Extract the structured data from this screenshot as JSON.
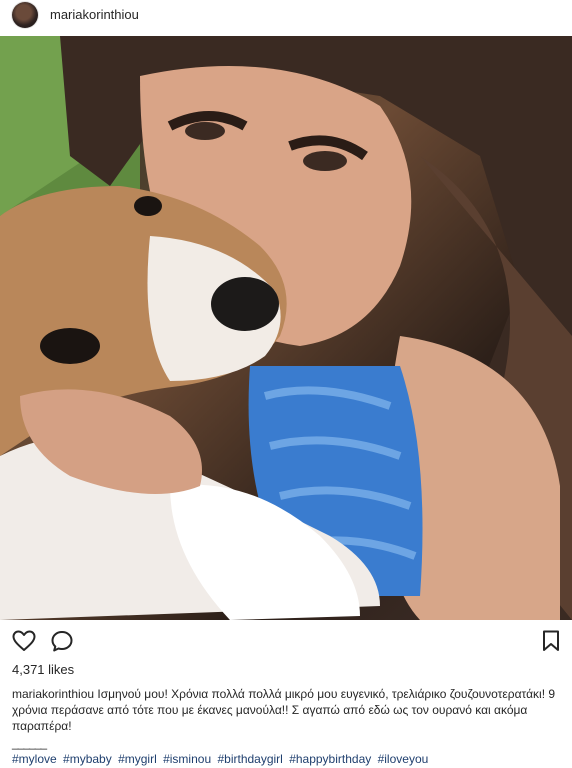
{
  "post": {
    "username": "mariakorinthiou",
    "likes": "4,371 likes",
    "caption_user": "mariakorinthiou",
    "caption_text": "Ισμηνού μου! Χρόνια πολλά πολλά μικρό μου ευγενικό, τρελιάρικο ζουζουνοτερατάκι! 9 χρόνια περάσανε από τότε που με έκανες μανούλα!! Σ αγαπώ από εδώ ως τον ουρανό και ακόμα παραπέρα!",
    "divider": "______",
    "hashtags": [
      "#mylove",
      "#mybaby",
      "#mygirl",
      "#isminou",
      "#birthdaygirl",
      "#happybirthday",
      "#iloveyou"
    ]
  },
  "icons": {
    "like": "heart-icon",
    "comment": "comment-icon",
    "save": "bookmark-icon"
  }
}
